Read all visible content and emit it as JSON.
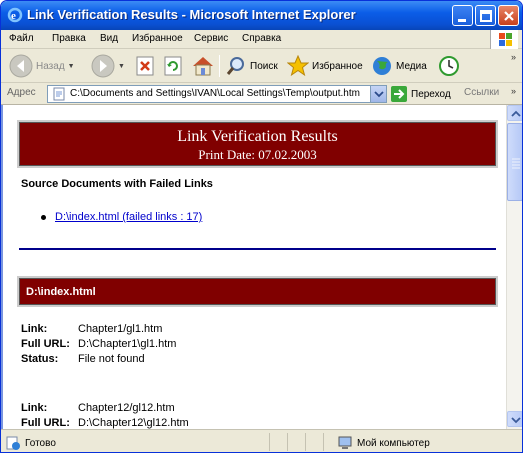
{
  "window": {
    "title": "Link Verification Results - Microsoft Internet Explorer"
  },
  "menu": {
    "items": [
      {
        "label": "Файл"
      },
      {
        "label": "Правка"
      },
      {
        "label": "Вид"
      },
      {
        "label": "Избранное"
      },
      {
        "label": "Сервис"
      },
      {
        "label": "Справка"
      }
    ]
  },
  "toolbar": {
    "back_label": "Назад",
    "search_label": "Поиск",
    "favorites_label": "Избранное",
    "media_label": "Медиа"
  },
  "address": {
    "label": "Адрес",
    "value": "C:\\Documents and Settings\\IVAN\\Local Settings\\Temp\\output.htm",
    "go_label": "Переход",
    "links_label": "Ссылки"
  },
  "page": {
    "header_title": "Link Verification Results",
    "header_date": "Print Date: 07.02.2003",
    "section_heading": "Source Documents with Failed Links",
    "failed_doc_link": "D:\\index.html (failed links : 17)",
    "file_banner": "D:\\index.html",
    "entries": [
      {
        "link_key": "Link:",
        "link_val": "Chapter1/gl1.htm",
        "url_key": "Full URL:",
        "url_val": "D:\\Chapter1\\gl1.htm",
        "status_key": "Status:",
        "status_val": "File not found"
      },
      {
        "link_key": "Link:",
        "link_val": "Chapter12/gl12.htm",
        "url_key": "Full URL:",
        "url_val": "D:\\Chapter12\\gl12.htm"
      }
    ]
  },
  "status": {
    "left_text": "Готово",
    "zone_text": "Мой компьютер"
  },
  "colors": {
    "banner_bg": "#800000",
    "rule": "#00008b",
    "link": "#0000cc"
  }
}
